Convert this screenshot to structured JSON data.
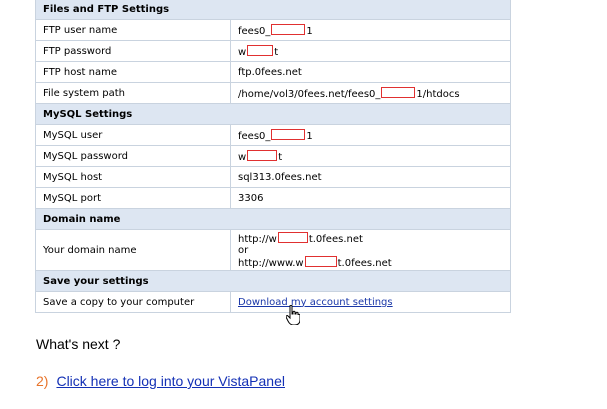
{
  "sections": [
    {
      "title": "Files and FTP Settings",
      "rows": [
        {
          "label": "FTP user name",
          "pre": "fees0_",
          "mask_w": 32,
          "post": "1"
        },
        {
          "label": "FTP password",
          "pre": "w",
          "mask_w": 24,
          "post": "t"
        },
        {
          "label": "FTP host name",
          "value": "ftp.0fees.net"
        },
        {
          "label": "File system path",
          "pre": "/home/vol3/0fees.net/fees0_",
          "mask_w": 32,
          "post": "1/htdocs"
        }
      ]
    },
    {
      "title": "MySQL Settings",
      "rows": [
        {
          "label": "MySQL user",
          "pre": "fees0_",
          "mask_w": 32,
          "post": "1"
        },
        {
          "label": "MySQL password",
          "pre": "w",
          "mask_w": 28,
          "post": "t"
        },
        {
          "label": "MySQL host",
          "value": "sql313.0fees.net"
        },
        {
          "label": "MySQL port",
          "value": "3306"
        }
      ]
    },
    {
      "title": "Domain name",
      "domain_label": "Your domain name",
      "line1_pre": "http://w",
      "line1_post": "t.0fees.net",
      "line2": "or",
      "line3_pre": "http://www.w",
      "line3_post": "t.0fees.net"
    },
    {
      "title": "Save your settings",
      "save_label": "Save a copy to your computer",
      "download_link": "Download my account settings"
    }
  ],
  "whats_next": "What's next ?",
  "next_step": {
    "number": "2)",
    "link": "Click here to log into your VistaPanel"
  },
  "colors": {
    "section_bg": "#dde6f2",
    "border": "#c9d3df",
    "redaction": "#e03030",
    "link": "#1a37a8",
    "step_number": "#e8742a"
  }
}
